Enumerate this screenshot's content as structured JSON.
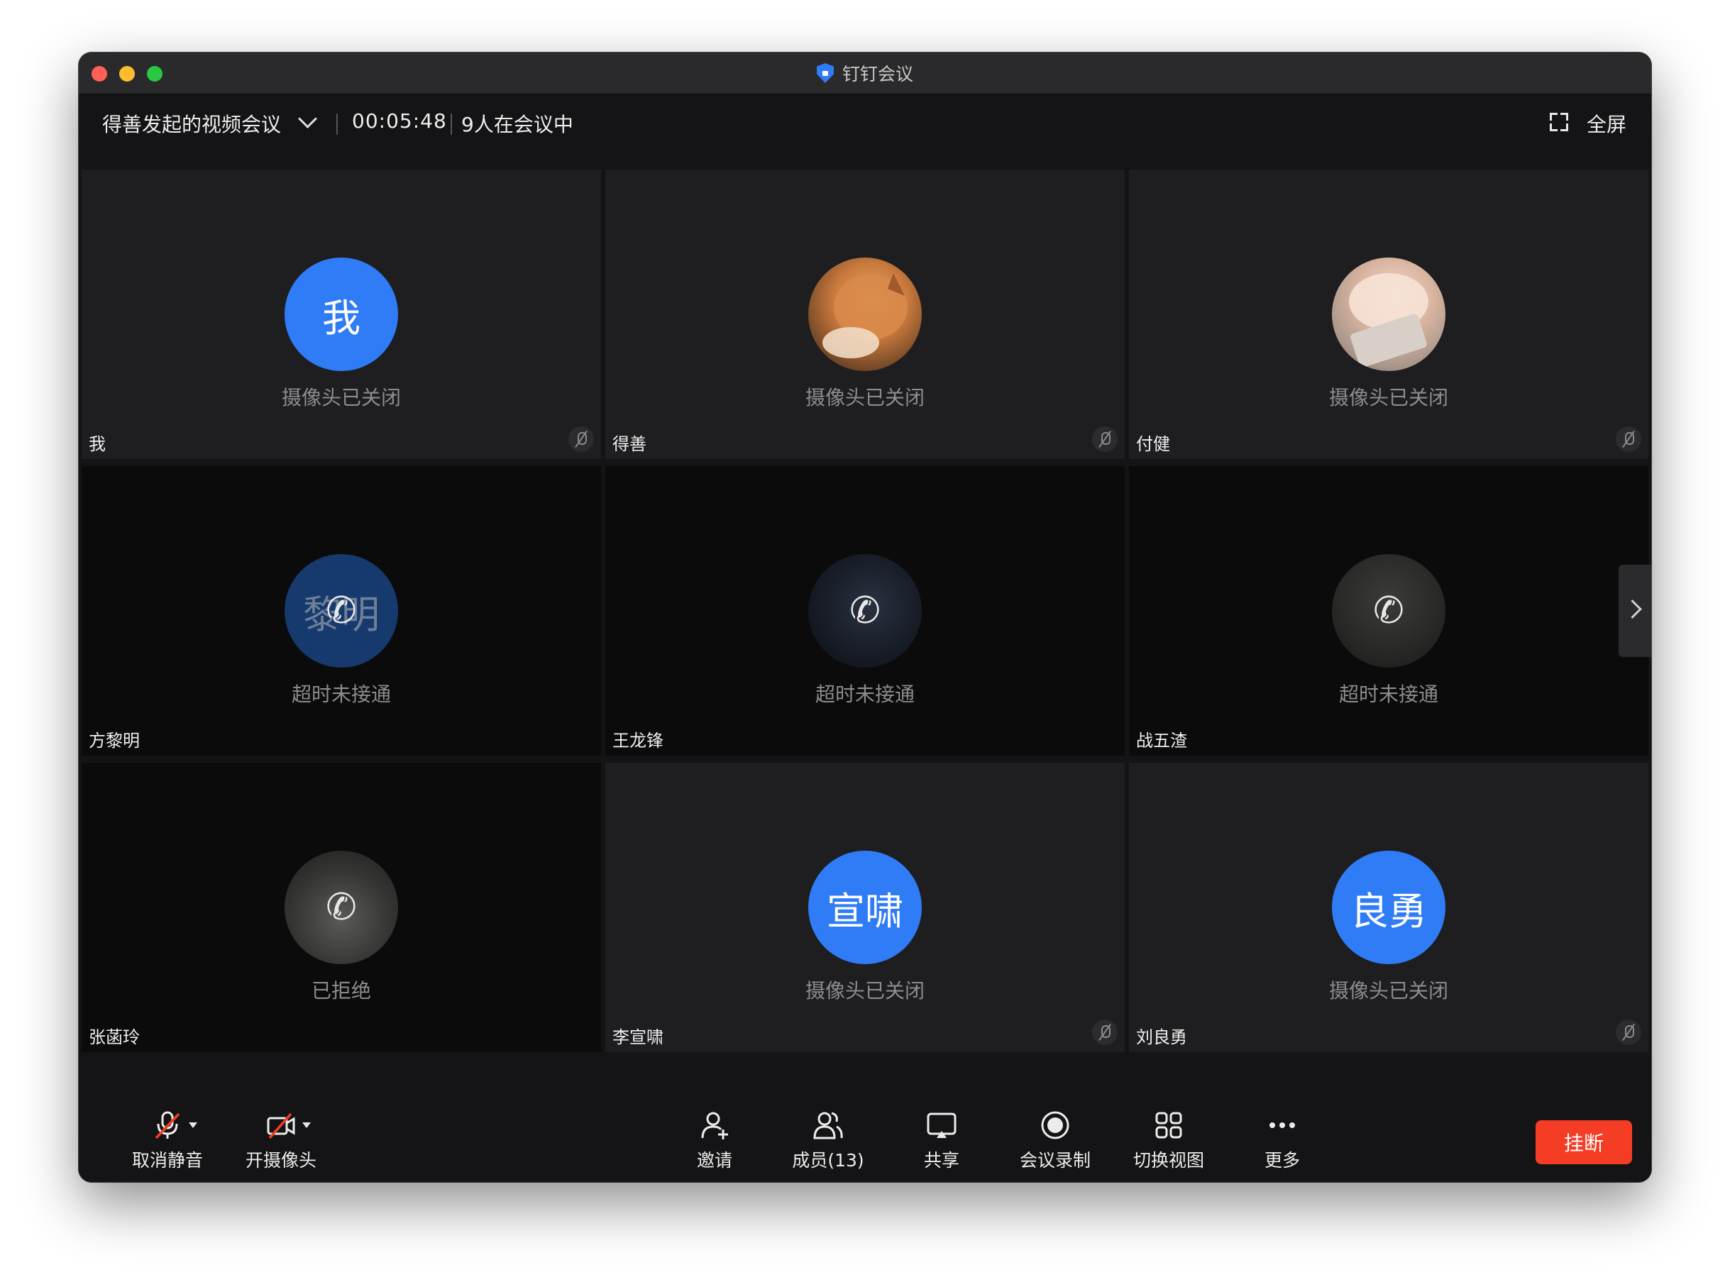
{
  "window": {
    "title": "钉钉会议"
  },
  "header": {
    "meeting_title": "得善发起的视频会议",
    "timer": "00:05:48",
    "participants": "9人在会议中",
    "fullscreen_label": "全屏"
  },
  "tiles": [
    {
      "name": "我",
      "avatar_text": "我",
      "status": "摄像头已关闭",
      "avatar_style": "blue",
      "muted": true
    },
    {
      "name": "得善",
      "avatar_text": "",
      "status": "摄像头已关闭",
      "avatar_style": "photo",
      "muted": true
    },
    {
      "name": "付健",
      "avatar_text": "",
      "status": "摄像头已关闭",
      "avatar_style": "photo",
      "muted": true
    },
    {
      "name": "方黎明",
      "avatar_text": "黎明",
      "status": "超时未接通",
      "avatar_style": "dim-blue",
      "calling_icon": "phone-icon"
    },
    {
      "name": "王龙锋",
      "avatar_text": "",
      "status": "超时未接通",
      "avatar_style": "photo",
      "calling_icon": "phone-icon"
    },
    {
      "name": "战五渣",
      "avatar_text": "",
      "status": "超时未接通",
      "avatar_style": "photo",
      "calling_icon": "phone-icon"
    },
    {
      "name": "张菡玲",
      "avatar_text": "",
      "status": "已拒绝",
      "avatar_style": "photo",
      "calling_icon": "phone-icon"
    },
    {
      "name": "李宣啸",
      "avatar_text": "宣啸",
      "status": "摄像头已关闭",
      "avatar_style": "blue",
      "muted": true
    },
    {
      "name": "刘良勇",
      "avatar_text": "良勇",
      "status": "摄像头已关闭",
      "avatar_style": "blue",
      "muted": true
    }
  ],
  "toolbar": {
    "unmute_label": "取消静音",
    "camera_label": "开摄像头",
    "invite_label": "邀请",
    "members_label": "成员(13)",
    "share_label": "共享",
    "record_label": "会议录制",
    "switch_view_label": "切换视图",
    "more_label": "更多",
    "hangup_label": "挂断"
  },
  "colors": {
    "accent_blue": "#2f7cf6",
    "hangup_red": "#f53d26",
    "window_bg": "#141416",
    "tile_bg": "#1e1e21"
  }
}
